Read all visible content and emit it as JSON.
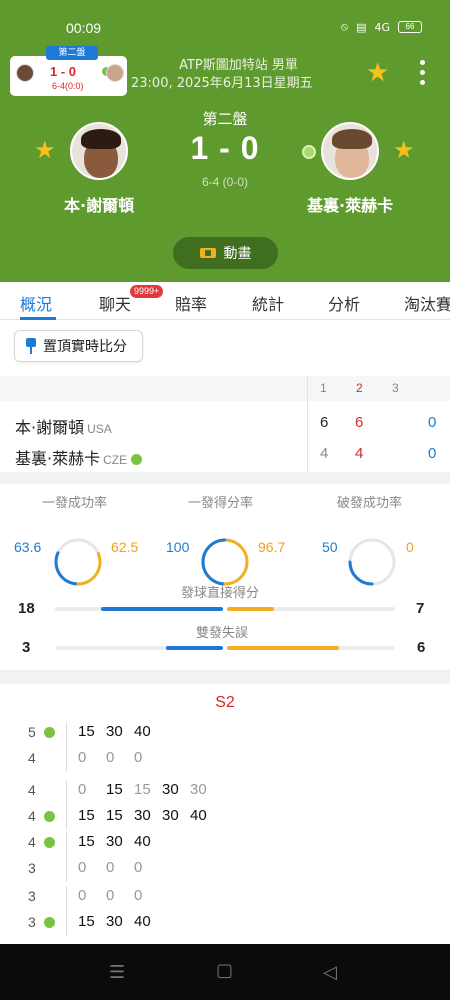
{
  "status": {
    "time": "00:09",
    "battery": "66",
    "network": "4G"
  },
  "mini": {
    "tag": "第二盤",
    "score": "1 - 0",
    "sub": "6-4(0:0)"
  },
  "header": {
    "tournament": "ATP斯圖加特站 男單",
    "datetime": "23:00, 2025年6月13日星期五",
    "set_label": "第二盤",
    "score": "1 - 0",
    "sub_score": "6-4 (0-0)",
    "anim_label": "動畫"
  },
  "players": [
    {
      "name": "本·謝爾頓",
      "country": "USA",
      "sets": [
        "6",
        "6",
        "0"
      ]
    },
    {
      "name": "基裏·萊赫卡",
      "country": "CZE",
      "sets": [
        "4",
        "4",
        "0"
      ]
    }
  ],
  "tabs": [
    "概況",
    "聊天",
    "賠率",
    "統計",
    "分析",
    "淘汰賽"
  ],
  "chat_badge": "9999+",
  "pin_label": "置頂實時比分",
  "set_headers": [
    "1",
    "2",
    "3"
  ],
  "stats": {
    "rings": [
      {
        "label": "一發成功率",
        "left": "63.6",
        "right": "62.5",
        "left_pct": 63.6,
        "right_pct": 62.5
      },
      {
        "label": "一發得分率",
        "left": "100",
        "right": "96.7",
        "left_pct": 100,
        "right_pct": 96.7
      },
      {
        "label": "破發成功率",
        "left": "50",
        "right": "0",
        "left_pct": 50,
        "right_pct": 0
      }
    ],
    "bars": [
      {
        "label": "發球直接得分",
        "left": "18",
        "right": "7"
      },
      {
        "label": "雙發失誤",
        "left": "3",
        "right": "6"
      }
    ]
  },
  "pbp": {
    "title": "S2",
    "games": [
      {
        "top": "5",
        "bottom": "4",
        "top_pts": [
          "15",
          "30",
          "40"
        ],
        "bottom_pts": [
          "0",
          "0",
          "0"
        ],
        "winner": "top"
      },
      {
        "top": "4",
        "bottom": "4",
        "top_pts": [
          "0",
          "15",
          "15",
          "30",
          "30"
        ],
        "bottom_pts": [
          "15",
          "15",
          "30",
          "30",
          "40"
        ],
        "winner": "bottom"
      },
      {
        "top": "4",
        "bottom": "3",
        "top_pts": [
          "15",
          "30",
          "40"
        ],
        "bottom_pts": [
          "0",
          "0",
          "0"
        ],
        "winner": "top"
      },
      {
        "top": "3",
        "bottom": "3",
        "top_pts": [
          "0",
          "0",
          "0"
        ],
        "bottom_pts": [
          "15",
          "30",
          "40"
        ],
        "winner": "bottom"
      }
    ]
  },
  "colors": {
    "green": "#5f9a2f",
    "blue": "#1f7ad6",
    "orange": "#f2b01e",
    "red": "#d62828"
  }
}
